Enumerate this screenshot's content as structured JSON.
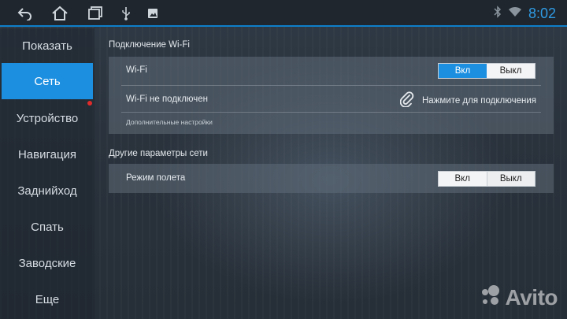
{
  "statusbar": {
    "icons": [
      "back-icon",
      "home-icon",
      "recent-apps-icon",
      "usb-icon",
      "image-icon"
    ],
    "right_icons": [
      "bluetooth-icon",
      "wifi-icon"
    ],
    "time": "8:02",
    "accent": "#0e7ec9"
  },
  "sidebar": {
    "items": [
      {
        "label": "Показать"
      },
      {
        "label": "Сеть",
        "active": true
      },
      {
        "label": "Устройство"
      },
      {
        "label": "Навигация"
      },
      {
        "label": "Заднийход"
      },
      {
        "label": "Спать"
      },
      {
        "label": "Заводские"
      },
      {
        "label": "Еще"
      }
    ],
    "active_color": "#1d8fe0"
  },
  "wifi_section": {
    "title": "Подключение Wi-Fi",
    "wifi_label": "Wi-Fi",
    "toggle": {
      "on": "Вкл",
      "off": "Выкл",
      "selected": "on"
    },
    "status_label": "Wi-Fi не подключен",
    "connect_label": "Нажмите для подключения",
    "connect_icon": "paperclip-icon",
    "advanced_label": "Дополнительные настройки"
  },
  "other_section": {
    "title": "Другие параметры сети",
    "airplane_label": "Режим полета",
    "toggle": {
      "on": "Вкл",
      "off": "Выкл",
      "selected": "off"
    }
  },
  "watermark": {
    "text": "Avito"
  }
}
